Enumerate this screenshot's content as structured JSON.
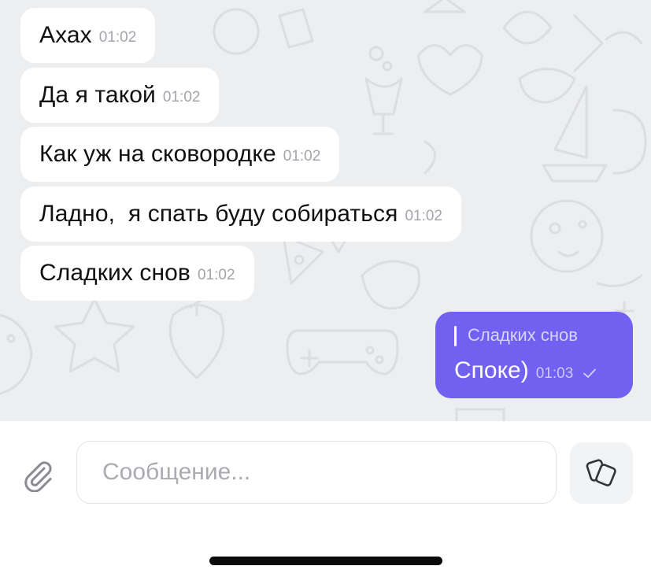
{
  "chat": {
    "messages_in": [
      {
        "text": "Ахах",
        "time": "01:02"
      },
      {
        "text": "Да я такой",
        "time": "01:02"
      },
      {
        "text": "Как уж на сковородке",
        "time": "01:02"
      },
      {
        "text": "Ладно,  я спать буду собираться",
        "time": "01:02"
      },
      {
        "text": "Сладких снов",
        "time": "01:02"
      }
    ],
    "message_out": {
      "reply_to": "Сладких снов",
      "text": "Споке)",
      "time": "01:03",
      "status_icon": "single-check-icon"
    }
  },
  "composer": {
    "placeholder": "Сообщение...",
    "value": "",
    "attach_icon": "paperclip-icon",
    "sticker_icon": "sticker-icon"
  },
  "colors": {
    "chat_background": "#edeef0",
    "incoming_bubble": "#ffffff",
    "outgoing_bubble": "#7161f0",
    "time_text": "#a2a5ab",
    "placeholder_text": "#a9abb1"
  }
}
